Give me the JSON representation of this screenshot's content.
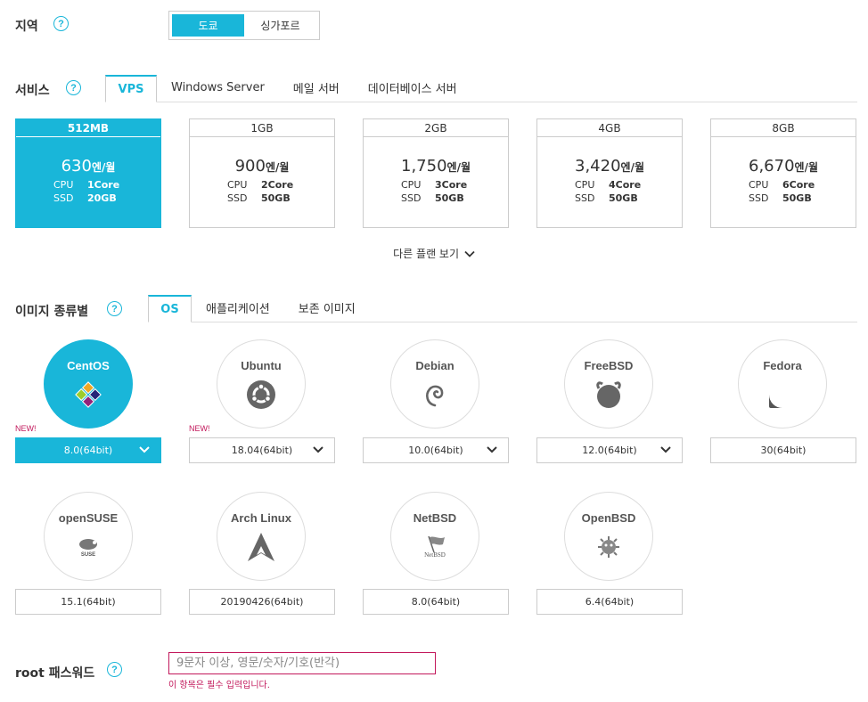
{
  "region": {
    "label": "지역",
    "help": "?",
    "options": [
      "도쿄",
      "싱가포르"
    ],
    "selected": "도쿄"
  },
  "service": {
    "label": "서비스",
    "help": "?",
    "tabs": [
      "VPS",
      "Windows Server",
      "메일 서버",
      "데이터베이스 서버"
    ],
    "active_tab": "VPS"
  },
  "plans": [
    {
      "name": "512MB",
      "price": "630",
      "unit": "엔/월",
      "cpu_label": "CPU",
      "cpu": "1Core",
      "ssd_label": "SSD",
      "ssd": "20GB",
      "selected": true
    },
    {
      "name": "1GB",
      "price": "900",
      "unit": "엔/월",
      "cpu_label": "CPU",
      "cpu": "2Core",
      "ssd_label": "SSD",
      "ssd": "50GB",
      "selected": false
    },
    {
      "name": "2GB",
      "price": "1,750",
      "unit": "엔/월",
      "cpu_label": "CPU",
      "cpu": "3Core",
      "ssd_label": "SSD",
      "ssd": "50GB",
      "selected": false
    },
    {
      "name": "4GB",
      "price": "3,420",
      "unit": "엔/월",
      "cpu_label": "CPU",
      "cpu": "4Core",
      "ssd_label": "SSD",
      "ssd": "50GB",
      "selected": false
    },
    {
      "name": "8GB",
      "price": "6,670",
      "unit": "엔/월",
      "cpu_label": "CPU",
      "cpu": "6Core",
      "ssd_label": "SSD",
      "ssd": "50GB",
      "selected": false
    }
  ],
  "more_plans": "다른 플랜 보기",
  "image": {
    "label": "이미지 종류별",
    "help": "?",
    "tabs": [
      "OS",
      "애플리케이션",
      "보존 이미지"
    ],
    "active_tab": "OS"
  },
  "os_list": [
    {
      "name": "CentOS",
      "version": "8.0(64bit)",
      "new_badge": "NEW!",
      "dropdown": true,
      "selected": true,
      "icon": "centos-logo-icon"
    },
    {
      "name": "Ubuntu",
      "version": "18.04(64bit)",
      "new_badge": "NEW!",
      "dropdown": true,
      "selected": false,
      "icon": "ubuntu-logo-icon"
    },
    {
      "name": "Debian",
      "version": "10.0(64bit)",
      "new_badge": "",
      "dropdown": true,
      "selected": false,
      "icon": "debian-logo-icon"
    },
    {
      "name": "FreeBSD",
      "version": "12.0(64bit)",
      "new_badge": "",
      "dropdown": true,
      "selected": false,
      "icon": "freebsd-logo-icon"
    },
    {
      "name": "Fedora",
      "version": "30(64bit)",
      "new_badge": "",
      "dropdown": false,
      "selected": false,
      "icon": "fedora-logo-icon"
    },
    {
      "name": "openSUSE",
      "version": "15.1(64bit)",
      "new_badge": "",
      "dropdown": false,
      "selected": false,
      "icon": "opensuse-logo-icon"
    },
    {
      "name": "Arch Linux",
      "version": "20190426(64bit)",
      "new_badge": "",
      "dropdown": false,
      "selected": false,
      "icon": "archlinux-logo-icon"
    },
    {
      "name": "NetBSD",
      "version": "8.0(64bit)",
      "new_badge": "",
      "dropdown": false,
      "selected": false,
      "icon": "netbsd-logo-icon"
    },
    {
      "name": "OpenBSD",
      "version": "6.4(64bit)",
      "new_badge": "",
      "dropdown": false,
      "selected": false,
      "icon": "openbsd-logo-icon"
    }
  ],
  "root_password": {
    "label": "root 패스워드",
    "help": "?",
    "placeholder": "9문자 이상, 영문/숫자/기호(반각)",
    "error": "이 항목은 필수 입력입니다."
  },
  "colors": {
    "accent": "#19b6d9",
    "error": "#c2185b",
    "border": "#cccccc"
  }
}
